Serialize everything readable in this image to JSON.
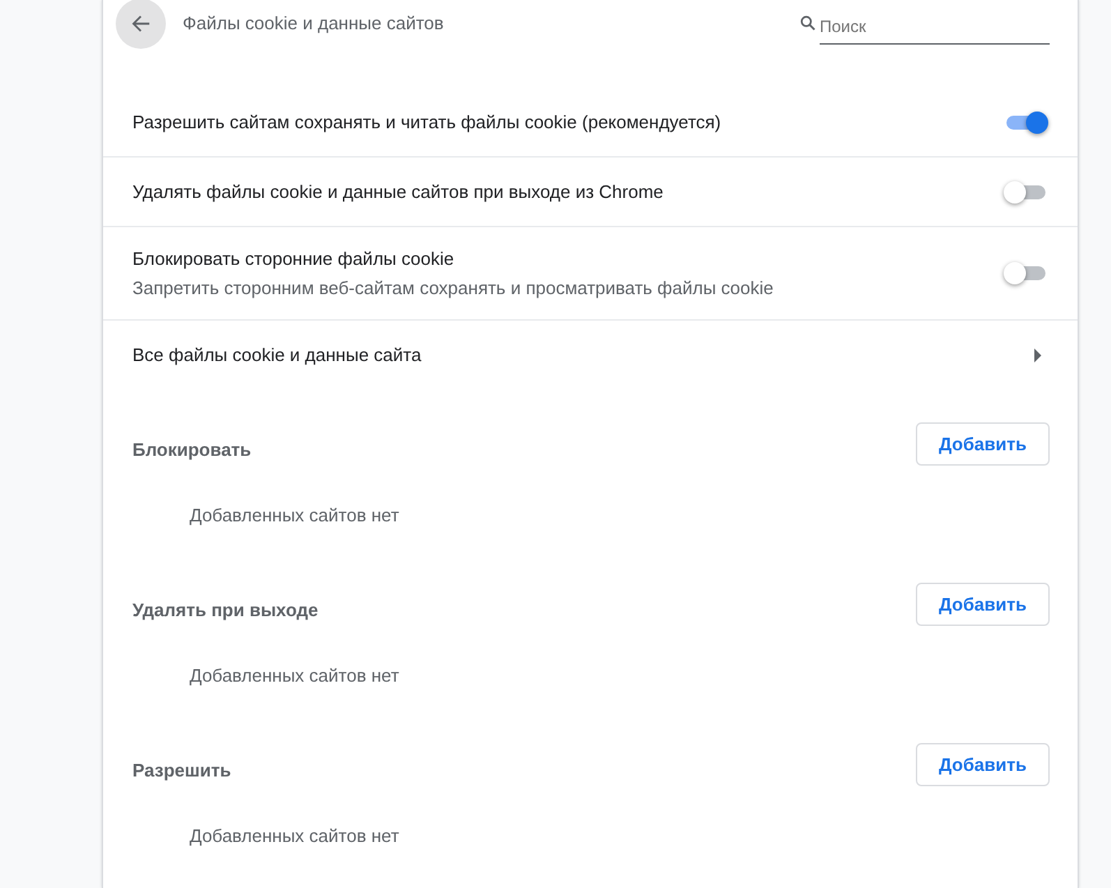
{
  "header": {
    "title": "Файлы cookie и данные сайтов",
    "search": {
      "placeholder": "Поиск"
    }
  },
  "settings": [
    {
      "kind": "toggle",
      "label": "Разрешить сайтам сохранять и читать файлы cookie (рекомендуется)",
      "on": true
    },
    {
      "kind": "toggle",
      "label": "Удалять файлы cookie и данные сайтов при выходе из Chrome",
      "on": false
    },
    {
      "kind": "toggle",
      "label": "Блокировать сторонние файлы cookie",
      "sublabel": "Запретить сторонним веб-сайтам сохранять и просматривать файлы cookie",
      "on": false
    },
    {
      "kind": "link",
      "label": "Все файлы cookie и данные сайта"
    }
  ],
  "site_lists": [
    {
      "title": "Блокировать",
      "button": "Добавить",
      "empty_text": "Добавленных сайтов нет"
    },
    {
      "title": "Удалять при выходе",
      "button": "Добавить",
      "empty_text": "Добавленных сайтов нет"
    },
    {
      "title": "Разрешить",
      "button": "Добавить",
      "empty_text": "Добавленных сайтов нет"
    }
  ]
}
